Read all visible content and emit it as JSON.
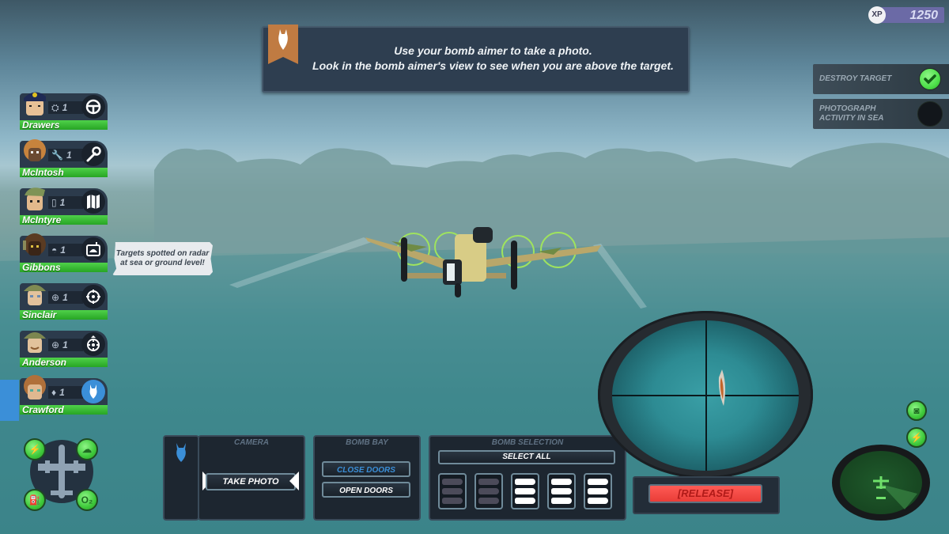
{
  "banner": {
    "icon": "bomb-icon",
    "line1": "Use your bomb aimer to take a photo.",
    "line2": "Look in the bomb aimer's view to see when you are above the target."
  },
  "xp": {
    "badge": "XP",
    "value": "1250"
  },
  "objectives": [
    {
      "label": "DESTROY TARGET",
      "status": "complete",
      "color": "#4ee04a"
    },
    {
      "label": "PHOTOGRAPH ACTIVITY IN SEA",
      "status": "incomplete",
      "color": "#12161b"
    }
  ],
  "crew": [
    {
      "name": "Drawers",
      "role": "pilot",
      "role_icon": "steering-wheel-icon",
      "level": "1",
      "selected": false
    },
    {
      "name": "McIntosh",
      "role": "engineer",
      "role_icon": "wrench-icon",
      "level": "1",
      "selected": false
    },
    {
      "name": "McIntyre",
      "role": "navigator",
      "role_icon": "map-icon",
      "level": "1",
      "selected": false
    },
    {
      "name": "Gibbons",
      "role": "radio-operator",
      "role_icon": "radar-icon",
      "level": "1",
      "selected": false
    },
    {
      "name": "Sinclair",
      "role": "gunner",
      "role_icon": "crosshair-icon",
      "level": "1",
      "selected": false
    },
    {
      "name": "Anderson",
      "role": "gunner",
      "role_icon": "turret-crosshair-icon",
      "level": "1",
      "selected": false
    },
    {
      "name": "Crawford",
      "role": "bomb-aimer",
      "role_icon": "bomb-icon",
      "level": "1",
      "selected": true
    }
  ],
  "tooltip": "Targets spotted on radar at sea or ground level!",
  "plane_status": [
    "power-icon",
    "fire-extinguisher-icon",
    "fuel-icon",
    "oxygen-icon"
  ],
  "controls": {
    "camera": {
      "title": "CAMERA",
      "take_photo": "TAKE PHOTO"
    },
    "bomb_bay": {
      "title": "BOMB BAY",
      "close_doors": "CLOSE DOORS",
      "open_doors": "OPEN DOORS",
      "active": "CLOSE DOORS"
    },
    "bomb_selection": {
      "title": "BOMB SELECTION",
      "select_all": "SELECT ALL",
      "slots": [
        {
          "bombs": 3,
          "available": false
        },
        {
          "bombs": 3,
          "available": false
        },
        {
          "bombs": 3,
          "available": true
        },
        {
          "bombs": 3,
          "available": true
        },
        {
          "bombs": 3,
          "available": true
        }
      ]
    },
    "release": "[RELEASE]"
  },
  "side_buttons": [
    "armor-icon",
    "power-icon"
  ],
  "colors": {
    "accent_blue": "#3b8fd8",
    "health_green": "#3ac836",
    "release_red": "#f24a45",
    "panel": "#1d2630"
  }
}
